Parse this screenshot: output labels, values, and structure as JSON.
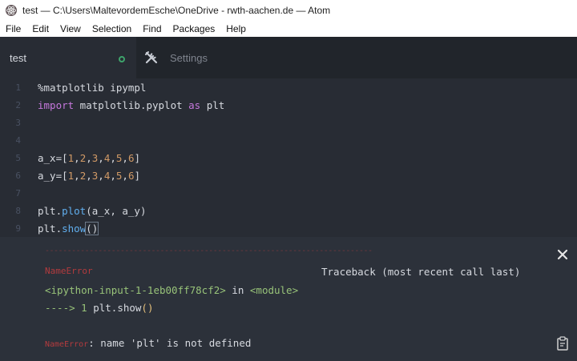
{
  "window": {
    "title": "test — C:\\Users\\MaltevordemEsche\\OneDrive - rwth-aachen.de — Atom"
  },
  "menu": [
    "File",
    "Edit",
    "View",
    "Selection",
    "Find",
    "Packages",
    "Help"
  ],
  "tabs": {
    "active": "test",
    "settings": "Settings"
  },
  "editor": {
    "line_numbers": [
      "1",
      "2",
      "3",
      "4",
      "5",
      "6",
      "7",
      "8",
      "9"
    ],
    "lines": {
      "l1": "%matplotlib ipympl",
      "l2_kw1": "import",
      "l2_mod": " matplotlib.pyplot ",
      "l2_kw2": "as",
      "l2_alias": " plt",
      "l5_pre": "a_x=[",
      "l6_pre": "a_y=[",
      "nums": [
        "1",
        "2",
        "3",
        "4",
        "5",
        "6"
      ],
      "l8_obj": "plt.",
      "l8_fn": "plot",
      "l8_args": "(a_x, a_y)",
      "l9_obj": "plt.",
      "l9_fn": "show",
      "l9_parens": "()"
    }
  },
  "output": {
    "separator": "--------------------------------------------------------------------------",
    "error_name": "NameError",
    "traceback_header": "Traceback (most recent call last)",
    "input_ref": "<ipython-input-1-1eb00ff78cf2>",
    "in_word": " in ",
    "module_ref": "<module>",
    "arrow": "----> ",
    "arrow_line_num": "1",
    "arrow_code": " plt.show",
    "arrow_parens": "()",
    "final_error": "NameError",
    "final_message": ": name 'plt' is not defined"
  },
  "colors": {
    "background": "#282c34",
    "tabbar": "#21252b",
    "output_bg": "#2c313a",
    "keyword": "#c678dd",
    "number": "#d19a66",
    "function": "#61afef",
    "error": "#b33b3e",
    "green": "#98c379"
  }
}
